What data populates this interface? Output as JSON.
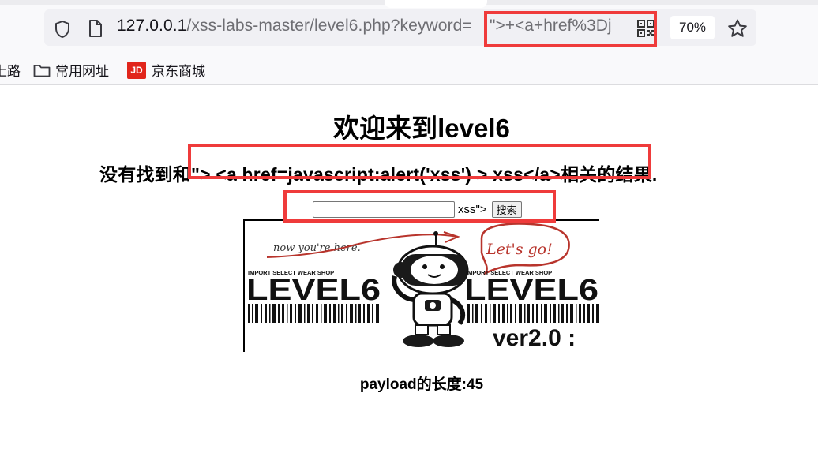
{
  "browser": {
    "url_host": "127.0.0.1",
    "url_path": "/xss-labs-master/level6.php?keyword=",
    "url_query_highlight": "\">+<a+href%3Dj",
    "zoom": "70%"
  },
  "bookmarks": {
    "partial_left": "上路",
    "items": [
      {
        "label": "常用网址",
        "icon": "folder-icon"
      },
      {
        "label": "京东商城",
        "icon": "jd-icon",
        "icon_text": "JD"
      }
    ]
  },
  "page": {
    "heading": "欢迎来到level6",
    "result_prefix": "没有找到和",
    "result_payload": "\">  <a href=javascript:alert('xss') > xss</a>",
    "result_suffix": "相关的结果.",
    "input_value": "",
    "input_trailing_text": "xss\">",
    "search_button": "搜索",
    "image_texts": {
      "note": "now you're here.",
      "speech": "Let's go!",
      "shop_left": "IMPORT SELECT WEAR SHOP",
      "level_left": "LEVEL6",
      "shop_right": "IMPORT SELECT WEAR SHOP",
      "level_right": "LEVEL6",
      "version": "ver2.0 :"
    },
    "payload_length_text": "payload的长度:45"
  },
  "colors": {
    "highlight_box": "#ef3b3b",
    "toolbar_bg": "#f9f9fb",
    "urlbar_bg": "#f0f0f4"
  }
}
